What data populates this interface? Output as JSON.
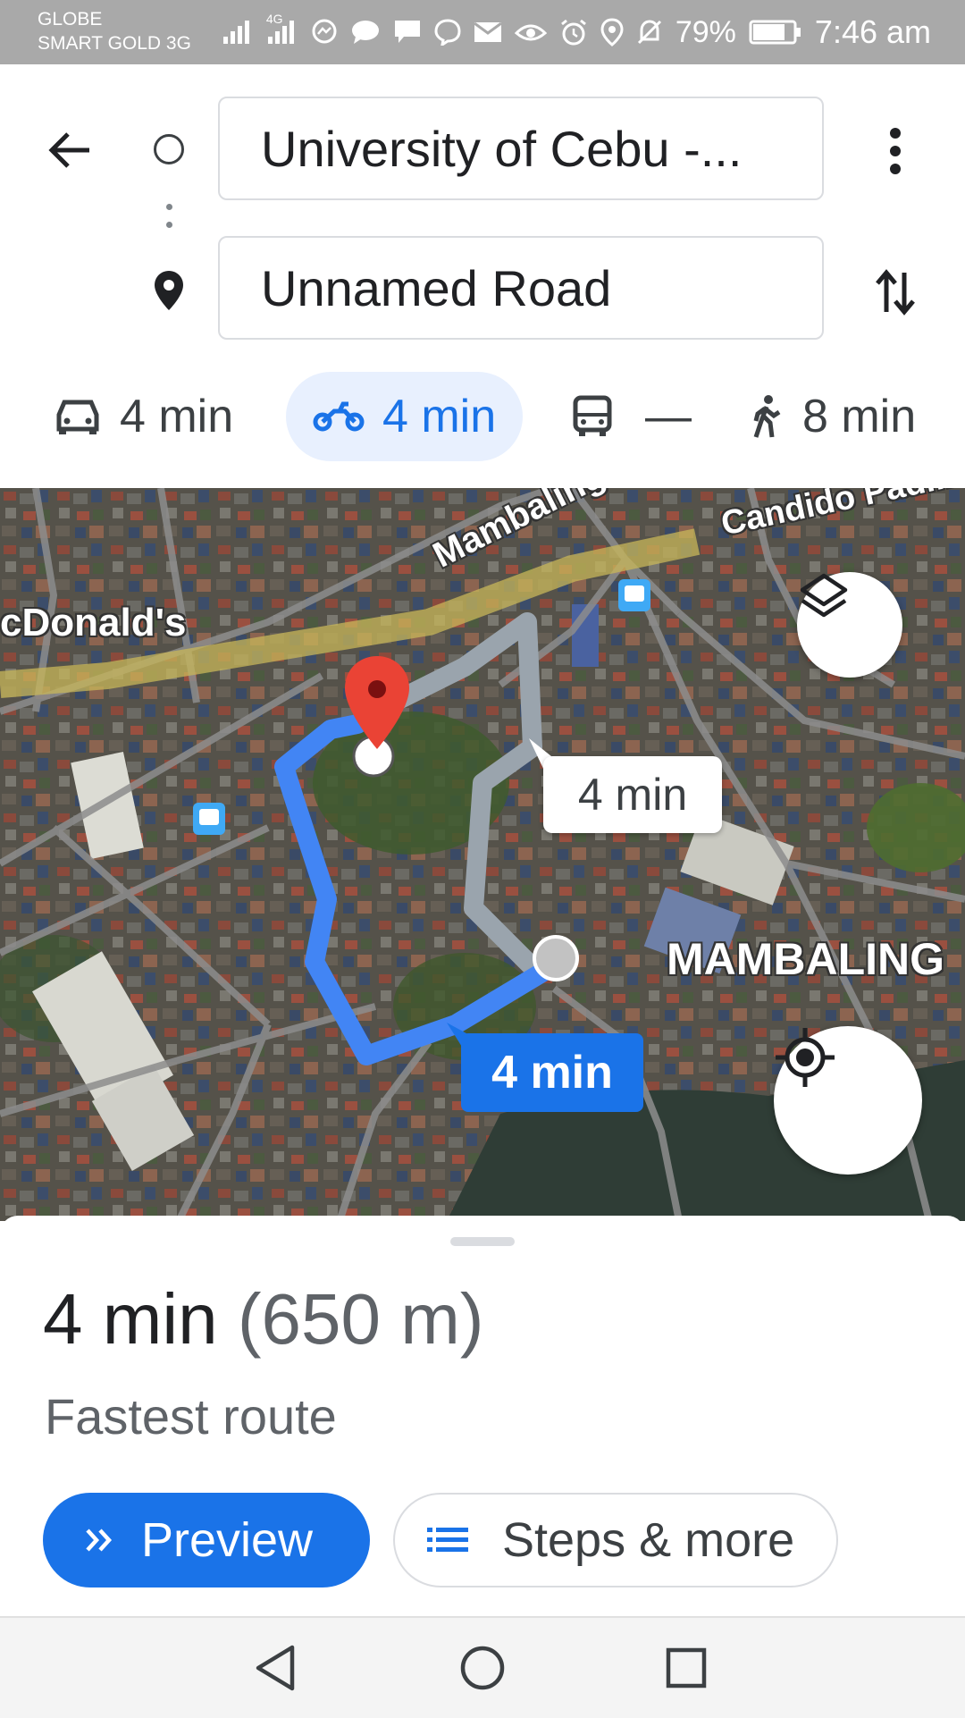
{
  "status_bar": {
    "carrier_line1": "GLOBE",
    "carrier_line2": "SMART GOLD 3G",
    "network_badge": "4G",
    "battery_percent": "79%",
    "time": "7:46 am",
    "battery_level": 0.79,
    "icons": [
      "signal-icon",
      "signal-icon",
      "messenger-icon",
      "chat-icon",
      "message-icon",
      "viber-icon",
      "mail-icon",
      "eye-icon",
      "alarm-icon",
      "location-icon",
      "bell-off-icon",
      "battery-icon"
    ]
  },
  "header": {
    "origin": "University of Cebu -...",
    "destination": "Unnamed Road"
  },
  "modes": [
    {
      "name": "car",
      "icon": "car-icon",
      "label": "4 min",
      "selected": false
    },
    {
      "name": "motorcycle",
      "icon": "motorcycle-icon",
      "label": "4 min",
      "selected": true
    },
    {
      "name": "transit",
      "icon": "bus-icon",
      "label": "—",
      "selected": false
    },
    {
      "name": "walk",
      "icon": "walk-icon",
      "label": "8 min",
      "selected": false
    }
  ],
  "map": {
    "labels": {
      "mcdonalds": "cDonald's",
      "flyover": "Mambaling Fly",
      "candido": "Candido Padilla",
      "mambaling": "MAMBALING"
    },
    "alt_route_time": "4 min",
    "main_route_time": "4 min",
    "route_color": "#4285f4",
    "alt_route_color": "#aab4bf"
  },
  "sheet": {
    "duration": "4 min",
    "distance": "(650 m)",
    "subtitle": "Fastest route",
    "preview_label": "Preview",
    "steps_label": "Steps & more"
  },
  "colors": {
    "accent": "#1a73e8",
    "selected_mode_bg": "#e8f0fe",
    "pin_red": "#ea4335"
  }
}
